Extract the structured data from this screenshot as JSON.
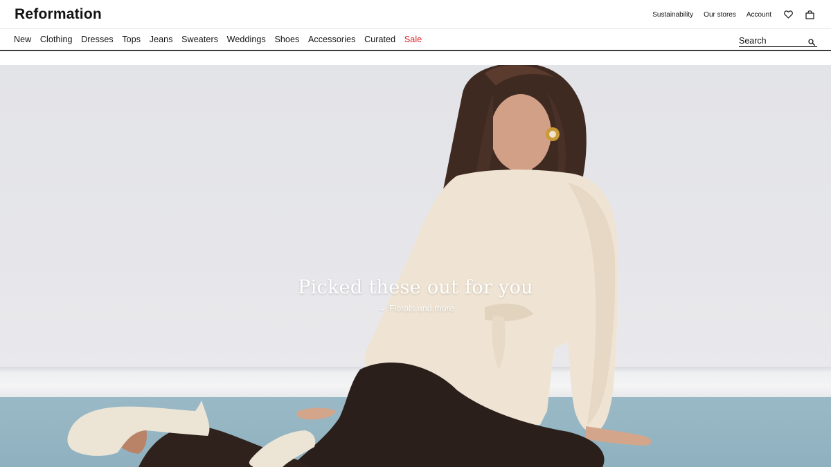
{
  "header": {
    "logo": "Reformation",
    "utility_links": [
      "Sustainability",
      "Our stores",
      "Account"
    ],
    "icons": [
      "heart-icon",
      "bag-icon"
    ]
  },
  "nav": {
    "items": [
      "New",
      "Clothing",
      "Dresses",
      "Tops",
      "Jeans",
      "Sweaters",
      "Weddings",
      "Shoes",
      "Accessories",
      "Curated",
      "Sale"
    ],
    "sale_color": "#d41f26"
  },
  "search": {
    "placeholder": "Search",
    "icon": "search-icon"
  },
  "hero": {
    "title": "Picked these out for you",
    "link_arrow": "→",
    "link_label": "Florals and more"
  }
}
